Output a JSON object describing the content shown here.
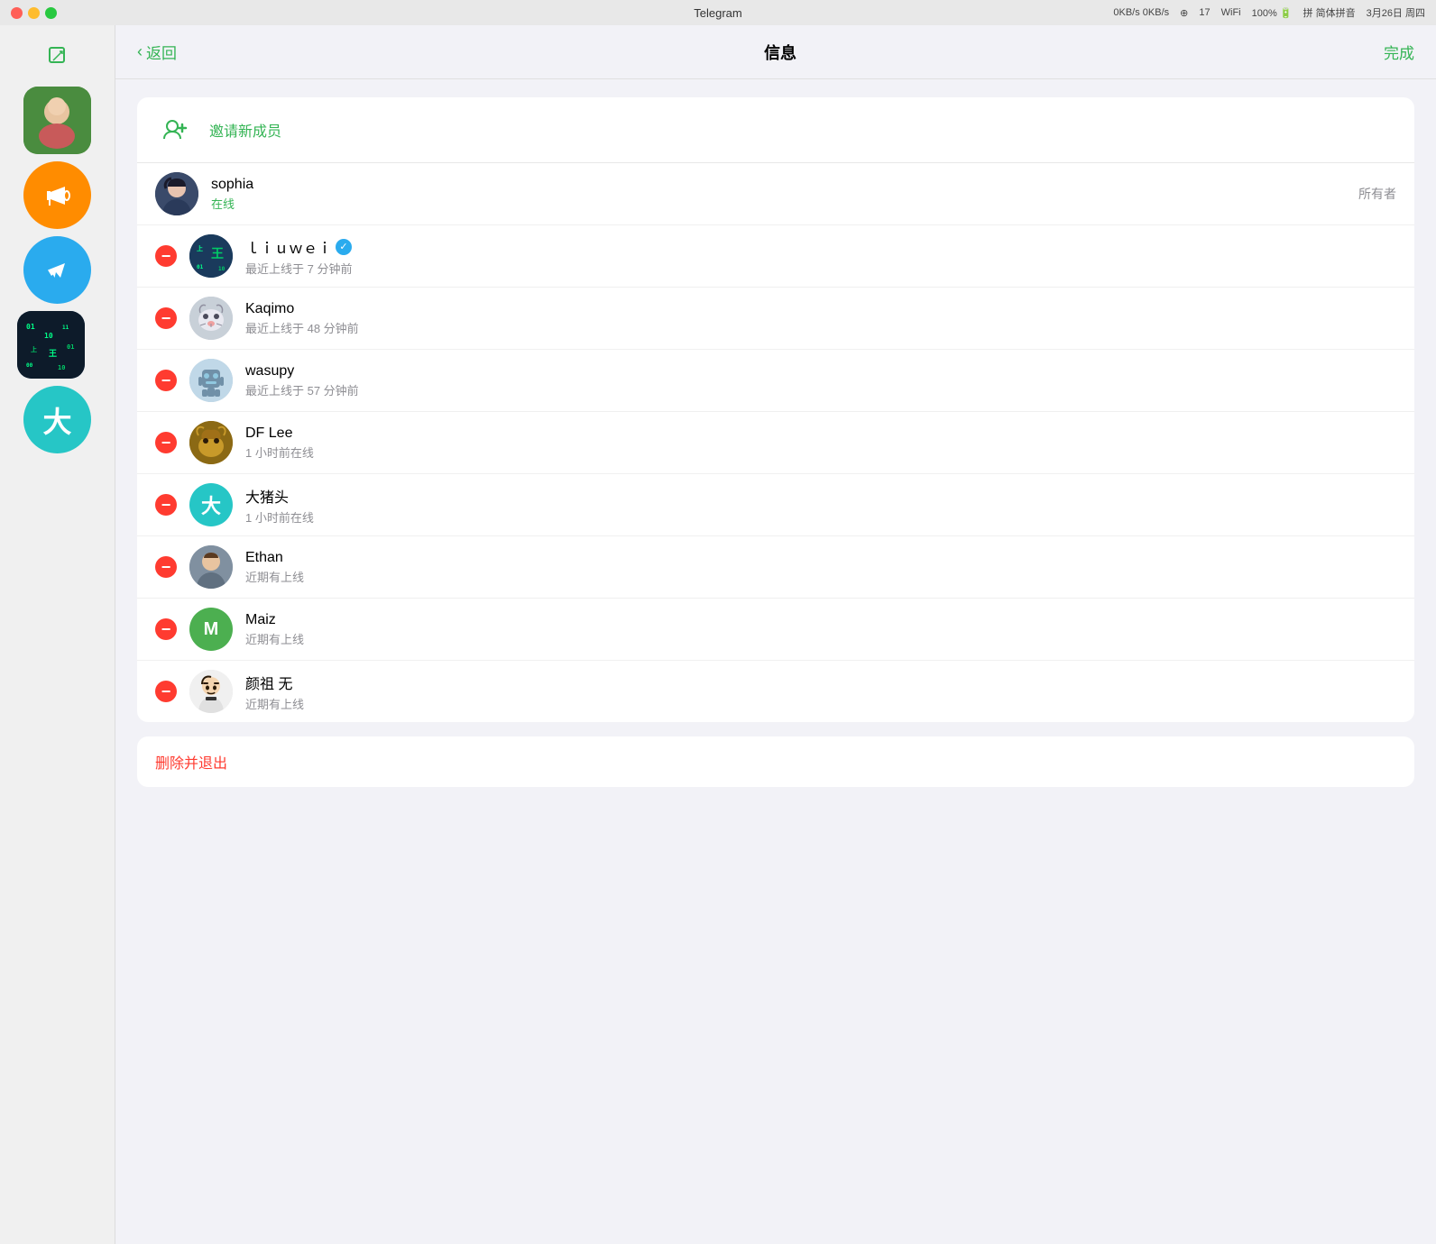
{
  "titlebar": {
    "title": "Telegram",
    "status": "3月26日 周四"
  },
  "header": {
    "back_label": "返回",
    "title": "信息",
    "done_label": "完成"
  },
  "sidebar": {
    "compose_label": "✎",
    "items": [
      {
        "label": "大",
        "color": "#26c6c6",
        "type": "circle"
      },
      {
        "label": "📢",
        "color": "#ff8c00",
        "type": "circle"
      },
      {
        "label": "✈",
        "color": "#2aabee",
        "type": "circle"
      },
      {
        "label": "",
        "color": "#1a1a2e",
        "type": "avatar-dark"
      }
    ]
  },
  "invite": {
    "label": "邀请新成员"
  },
  "members": [
    {
      "name": "sophia",
      "status": "在线",
      "status_online": true,
      "role": "所有者",
      "avatar_type": "anime",
      "show_remove": false
    },
    {
      "name": "ｌｉｕｗｅｉ",
      "status": "最近上线于 7 分钟前",
      "status_online": false,
      "role": "",
      "avatar_type": "liuwei",
      "show_remove": true,
      "verified": true
    },
    {
      "name": "Kaqimo",
      "status": "最近上线于 48 分钟前",
      "status_online": false,
      "role": "",
      "avatar_type": "cat",
      "show_remove": true
    },
    {
      "name": "wasupy",
      "status": "最近上线于 57 分钟前",
      "status_online": false,
      "role": "",
      "avatar_type": "robot",
      "show_remove": true
    },
    {
      "name": "DF Lee",
      "status": "1 小时前在线",
      "status_online": false,
      "role": "",
      "avatar_type": "dragon",
      "show_remove": true
    },
    {
      "name": "大猪头",
      "status": "1 小时前在线",
      "status_online": false,
      "role": "",
      "avatar_type": "teal-da",
      "show_remove": true
    },
    {
      "name": "Ethan",
      "status": "近期有上线",
      "status_online": false,
      "role": "",
      "avatar_type": "person",
      "show_remove": true
    },
    {
      "name": "Maiz",
      "status": "近期有上线",
      "status_online": false,
      "role": "",
      "avatar_type": "green-m",
      "show_remove": true
    },
    {
      "name": "颜祖 无",
      "status": "近期有上线",
      "status_online": false,
      "role": "",
      "avatar_type": "sticker",
      "show_remove": true
    }
  ],
  "danger": {
    "label": "删除并退出"
  }
}
